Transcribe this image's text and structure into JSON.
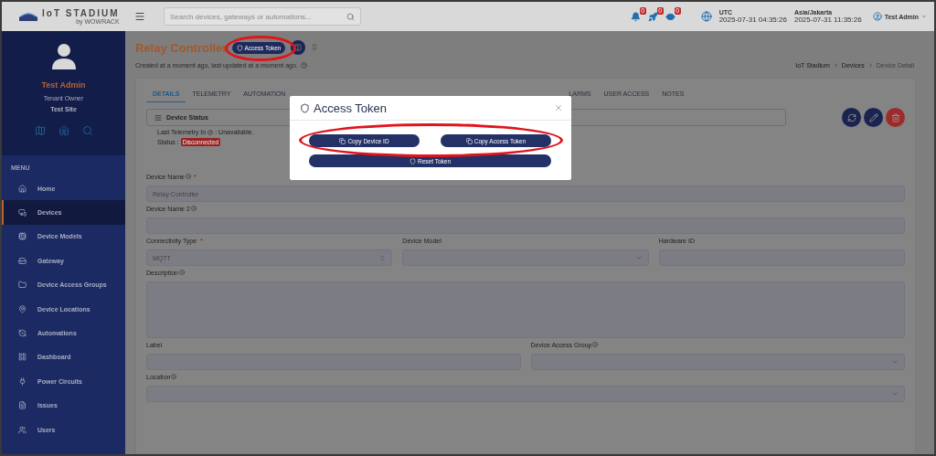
{
  "header": {
    "logo": "IoT STADIUM",
    "logo_sub": "by WOWRACK",
    "search": {
      "placeholder": "Search devices, gateways or automations..."
    },
    "badges": [
      "0",
      "0",
      "0"
    ],
    "clocks": [
      {
        "zone": "UTC",
        "time": "2025-07-31 04:35:26"
      },
      {
        "zone": "Asia/Jakarta",
        "time": "2025-07-31 11:35:26"
      }
    ],
    "user": "Test Admin"
  },
  "sidebar": {
    "profile": {
      "name": "Test Admin",
      "role": "Tenant Owner",
      "site": "Test Site"
    },
    "menu_title": "MENU",
    "items": [
      {
        "label": "Home",
        "selected": false
      },
      {
        "label": "Devices",
        "selected": true
      },
      {
        "label": "Device Models",
        "selected": false
      },
      {
        "label": "Gateway",
        "selected": false
      },
      {
        "label": "Device Access Groups",
        "selected": false
      },
      {
        "label": "Device Locations",
        "selected": false
      },
      {
        "label": "Automations",
        "selected": false
      },
      {
        "label": "Dashboard",
        "selected": false
      },
      {
        "label": "Power Circuits",
        "selected": false
      },
      {
        "label": "Issues",
        "selected": false
      },
      {
        "label": "Users",
        "selected": false
      }
    ]
  },
  "page": {
    "title": "Relay Controller",
    "token_button": "Access Token",
    "subtitle": "Created at a moment ago, last updated at a moment ago.",
    "breadcrumb": [
      "IoT Stadium",
      "Devices",
      "Device Detail"
    ]
  },
  "card": {
    "tabs": [
      {
        "label": "DETAILS",
        "selected": true
      },
      {
        "label": "TELEMETRY",
        "selected": false
      },
      {
        "label": "AUTOMATION",
        "selected": false
      },
      {
        "label": "LARMS",
        "selected": false
      },
      {
        "label": "USER ACCESS",
        "selected": false
      },
      {
        "label": "NOTES",
        "selected": false
      }
    ],
    "section": "Device Status",
    "telemetry_label": "Last Telemetry In",
    "telemetry_value": ": Unavailable.",
    "status_label": "Status :",
    "status": "Disconnected",
    "rows": [
      [
        {
          "label": "Device Name",
          "help": true,
          "mark": "*",
          "kind": "input",
          "value": "Relay Controller"
        }
      ],
      [
        {
          "label": "Device Name 2",
          "help": true,
          "kind": "input"
        }
      ],
      [
        {
          "label": "Connectivity Type",
          "mark": "*",
          "kind": "spinner",
          "value": "MQTT"
        },
        {
          "label": "Device Model",
          "kind": "select"
        },
        {
          "label": "Hardware ID",
          "kind": "input"
        }
      ],
      [
        {
          "label": "Description",
          "help": true,
          "kind": "textarea"
        }
      ],
      [
        {
          "label": "Label",
          "kind": "input"
        },
        {
          "label": "Device Access Group",
          "help": true,
          "kind": "select"
        }
      ],
      [
        {
          "label": "Location",
          "help": true,
          "kind": "select"
        }
      ]
    ]
  },
  "modal": {
    "title": "Access Token",
    "buttons": [
      "Copy Device ID",
      "Copy Access Token"
    ],
    "reset": "Reset Token"
  }
}
